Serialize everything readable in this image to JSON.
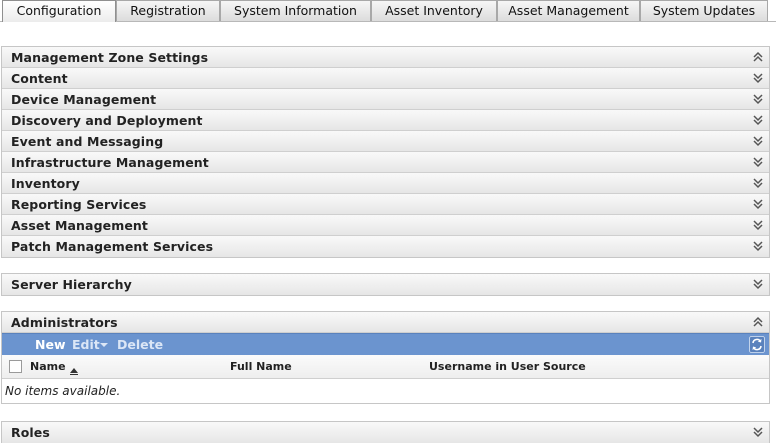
{
  "tabs": [
    {
      "label": "Configuration",
      "active": true
    },
    {
      "label": "Registration",
      "active": false
    },
    {
      "label": "System Information",
      "active": false
    },
    {
      "label": "Asset Inventory",
      "active": false
    },
    {
      "label": "Asset Management",
      "active": false
    },
    {
      "label": "System Updates",
      "active": false
    }
  ],
  "zone_settings": {
    "header": "Management Zone Settings",
    "header_icon": "chevron-up-double-icon",
    "items": [
      "Content",
      "Device Management",
      "Discovery and Deployment",
      "Event and Messaging",
      "Infrastructure Management",
      "Inventory",
      "Reporting Services",
      "Asset Management",
      "Patch Management Services"
    ],
    "item_icon": "chevron-down-double-icon"
  },
  "server_hierarchy": {
    "title": "Server Hierarchy",
    "icon": "chevron-down-double-icon"
  },
  "administrators": {
    "title": "Administrators",
    "icon": "chevron-up-double-icon",
    "toolbar": {
      "new": "New",
      "edit": "Edit",
      "delete": "Delete",
      "refresh_icon": "refresh-icon"
    },
    "columns": {
      "name": "Name",
      "full_name": "Full Name",
      "username": "Username in User Source"
    },
    "empty_text": "No items available."
  },
  "roles": {
    "title": "Roles",
    "icon": "chevron-down-double-icon"
  },
  "colors": {
    "toolbar": "#6b94cf",
    "panel_border": "#c6c6c6"
  }
}
